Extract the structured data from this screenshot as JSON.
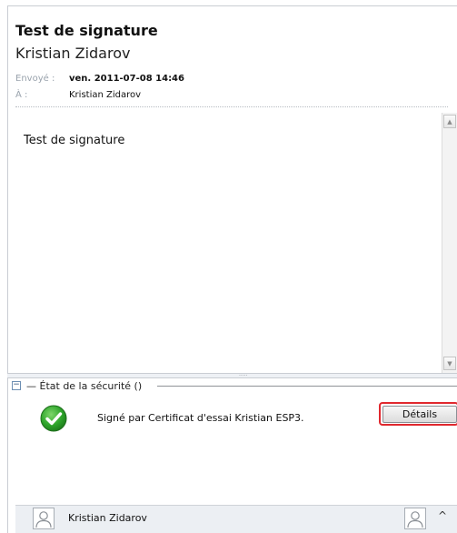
{
  "message": {
    "subject": "Test de signature",
    "sender_name": "Kristian Zidarov",
    "sent_label": "Envoyé :",
    "sent_value": "ven. 2011-07-08 14:46",
    "to_label": "À :",
    "to_value": "Kristian Zidarov",
    "body": "Test de signature"
  },
  "security": {
    "title": "État de la sécurité ()",
    "collapse_glyph": "−",
    "signed_text": "Signé par Certificat d'essai Kristian ESP3.",
    "details_label": "Détails",
    "status_icon": "green-check-icon",
    "status_color": "#2ea52b",
    "highlight_color": "#e0282e"
  },
  "people_pane": {
    "name": "Kristian Zidarov",
    "chevron": "^"
  },
  "scrollbar": {
    "up_glyph": "▲",
    "down_glyph": "▼"
  },
  "splitter": {
    "grip": "·····"
  }
}
